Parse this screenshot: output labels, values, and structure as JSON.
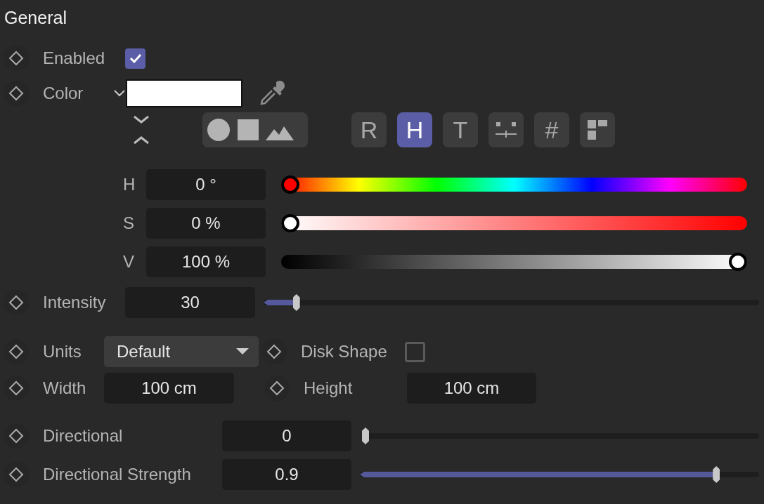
{
  "section": {
    "title": "General"
  },
  "enabled": {
    "label": "Enabled",
    "checked": true
  },
  "color": {
    "label": "Color",
    "expanded": true
  },
  "preview_shapes": [
    {
      "kind": "circle"
    },
    {
      "kind": "square"
    },
    {
      "kind": "mountains"
    }
  ],
  "color_modes": [
    {
      "kind": "text",
      "label": "R",
      "selected": false
    },
    {
      "kind": "text",
      "label": "H",
      "selected": true
    },
    {
      "kind": "text",
      "label": "T",
      "selected": false
    },
    {
      "kind": "mixer",
      "selected": false
    },
    {
      "kind": "text",
      "label": "#",
      "selected": false
    },
    {
      "kind": "swatches",
      "selected": false
    }
  ],
  "hsv": [
    {
      "label": "H",
      "value": "0 °",
      "kind": "hue",
      "level": 0
    },
    {
      "label": "S",
      "value": "0 %",
      "kind": "saturation",
      "level": 0
    },
    {
      "label": "V",
      "value": "100 %",
      "kind": "value",
      "level": 1
    }
  ],
  "intensity": {
    "label": "Intensity",
    "value": "30",
    "level": 0.06
  },
  "units": {
    "label": "Units",
    "value": "Default"
  },
  "disk_shape": {
    "label": "Disk Shape",
    "checked": false
  },
  "width": {
    "label": "Width",
    "value": "100 cm"
  },
  "height": {
    "label": "Height",
    "value": "100 cm"
  },
  "directional": {
    "label": "Directional",
    "value": "0",
    "level": 0
  },
  "directional_strength": {
    "label": "Directional Strength",
    "value": "0.9",
    "level": 0.9
  }
}
